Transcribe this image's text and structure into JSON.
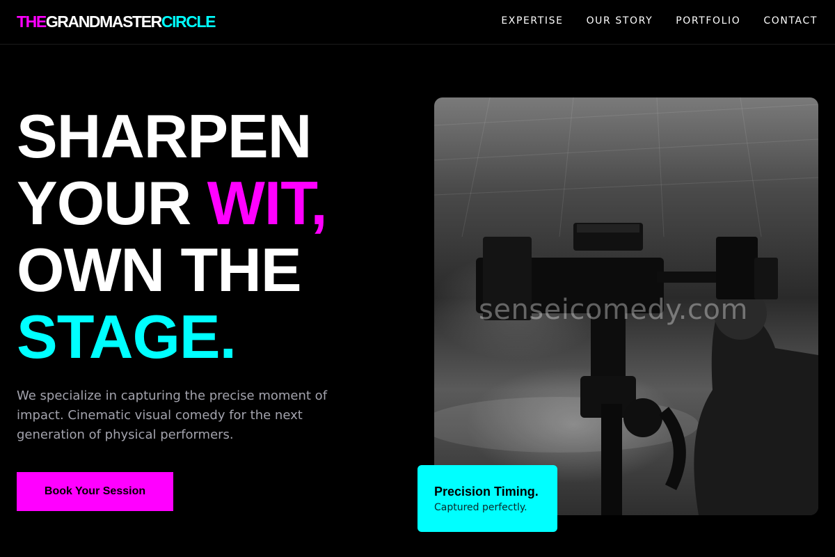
{
  "brand": {
    "part1": "THE",
    "part2": "GRANDMASTER",
    "part3": "CIRCLE",
    "colors": {
      "magenta": "#ff00ff",
      "cyan": "#00ffff",
      "background": "#000000"
    }
  },
  "nav": {
    "items": [
      "EXPERTISE",
      "OUR STORY",
      "PORTFOLIO",
      "CONTACT"
    ]
  },
  "hero": {
    "line1": "SHARPEN",
    "line2_start": "YOUR",
    "line2_accent": "WIT,",
    "line3": "OWN THE",
    "line4": "STAGE.",
    "description": "We specialize in capturing the precise moment of impact. Cinematic visual comedy for the next generation of physical performers.",
    "cta_label": "Book Your Session"
  },
  "photo": {
    "subject": "camera-operator-photo",
    "watermark": "senseicomedy.com"
  },
  "badge": {
    "title": "Precision Timing.",
    "subtitle": "Captured perfectly."
  }
}
